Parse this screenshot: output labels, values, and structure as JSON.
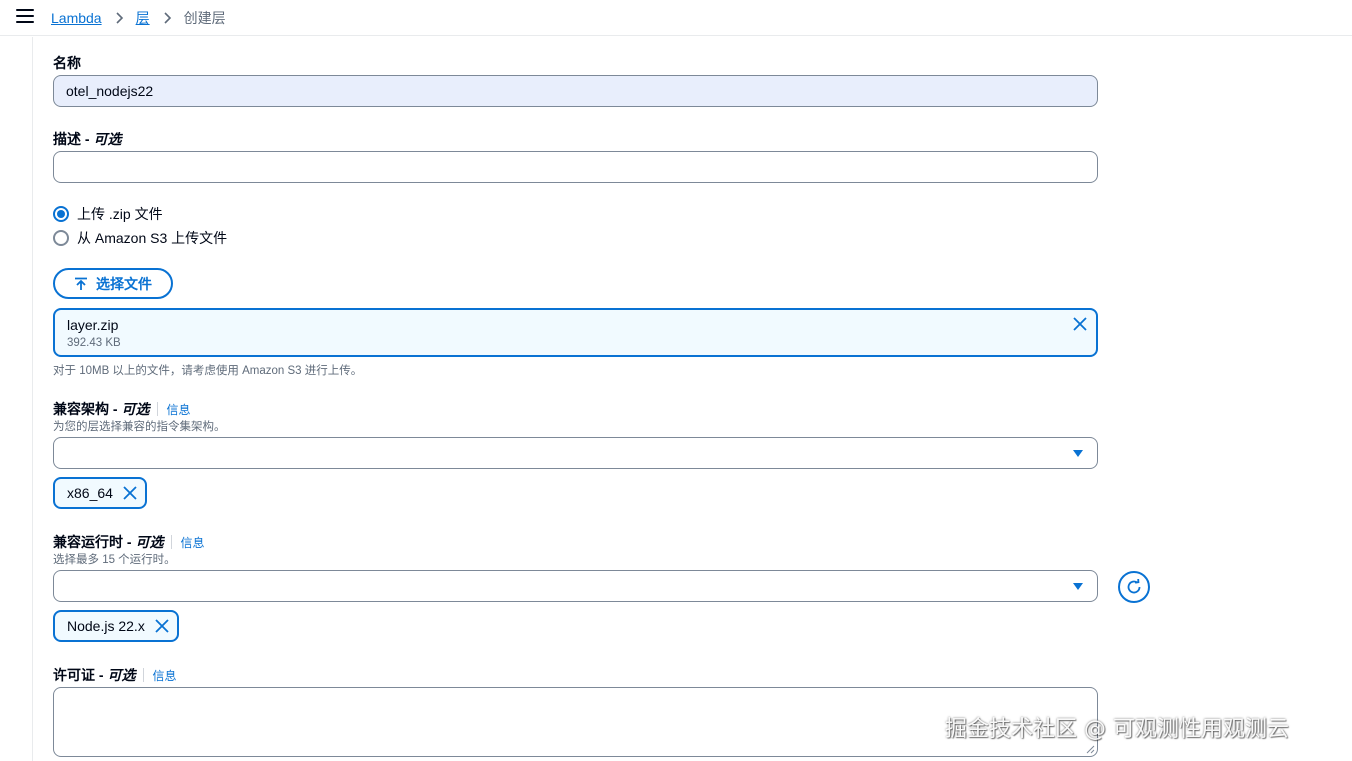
{
  "breadcrumb": {
    "items": [
      {
        "label": "Lambda"
      },
      {
        "label": "层"
      },
      {
        "label": "创建层"
      }
    ]
  },
  "form": {
    "name": {
      "label": "名称",
      "value": "otel_nodejs22"
    },
    "description": {
      "label": "描述 - ",
      "optional": "可选",
      "value": ""
    },
    "upload_options": [
      {
        "label": "上传 .zip 文件",
        "selected": true
      },
      {
        "label": "从 Amazon S3 上传文件",
        "selected": false
      }
    ],
    "choose_file_button": "选择文件",
    "file": {
      "name": "layer.zip",
      "size": "392.43 KB"
    },
    "file_hint": "对于 10MB 以上的文件，请考虑使用 Amazon S3 进行上传。",
    "architectures": {
      "label": "兼容架构 - ",
      "optional": "可选",
      "info": "信息",
      "description": "为您的层选择兼容的指令集架构。",
      "selected_tokens": [
        "x86_64"
      ]
    },
    "runtimes": {
      "label": "兼容运行时 - ",
      "optional": "可选",
      "info": "信息",
      "description": "选择最多 15 个运行时。",
      "selected_tokens": [
        "Node.js 22.x"
      ]
    },
    "license": {
      "label": "许可证 - ",
      "optional": "可选",
      "info": "信息",
      "value": ""
    }
  },
  "watermark": "掘金技术社区 @ 可观测性用观测云",
  "colors": {
    "accent": "#0972d3",
    "text": "#000716",
    "muted": "#5f6b7a",
    "border": "#7d8998"
  }
}
